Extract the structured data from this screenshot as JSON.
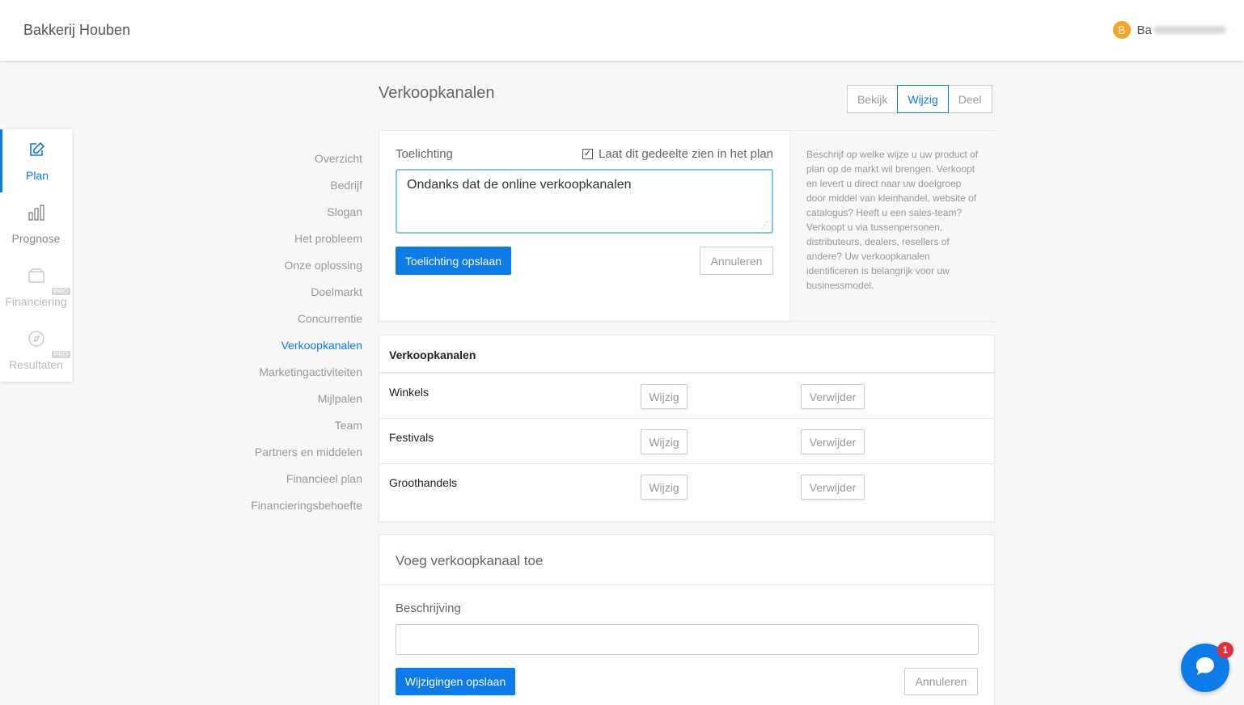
{
  "app": {
    "title": "Bakkerij Houben"
  },
  "user": {
    "avatar_letter": "B",
    "name_visible": "Ba"
  },
  "rail": [
    {
      "label": "Plan",
      "icon": "edit-icon",
      "state": "active"
    },
    {
      "label": "Prognose",
      "icon": "bar-chart-icon",
      "state": "normal"
    },
    {
      "label": "Financiering",
      "icon": "wallet-icon",
      "state": "disabled",
      "badge": "PRO"
    },
    {
      "label": "Resultaten",
      "icon": "compass-icon",
      "state": "disabled",
      "badge": "PRO"
    }
  ],
  "subnav": [
    "Overzicht",
    "Bedrijf",
    "Slogan",
    "Het probleem",
    "Onze oplossing",
    "Doelmarkt",
    "Concurrentie",
    "Verkoopkanalen",
    "Marketingactiviteiten",
    "Mijlpalen",
    "Team",
    "Partners en middelen",
    "Financieel plan",
    "Financieringsbehoefte"
  ],
  "subnav_active": "Verkoopkanalen",
  "page": {
    "title": "Verkoopkanalen"
  },
  "view_modes": {
    "items": [
      "Bekijk",
      "Wijzig",
      "Deel"
    ],
    "active": "Wijzig"
  },
  "explanation": {
    "label": "Toelichting",
    "show_in_plan_label": "Laat dit gedeelte zien in het plan",
    "show_in_plan_checked": true,
    "text": "Ondanks dat de online verkoopkanalen",
    "save_label": "Toelichting opslaan",
    "cancel_label": "Annuleren",
    "help": "Beschrijf op welke wijze u uw product of plan op de markt wil brengen. Verkoopt en levert u direct naar uw doelgroep door middel van kleinhandel, website of catalogus? Heeft u een sales-team? Verkoopt u via tussenpersonen, distributeurs, dealers, resellers of andere? Uw verkoopkanalen identificeren is belangrijk voor uw businessmodel."
  },
  "channels": {
    "header": "Verkoopkanalen",
    "edit_label": "Wijzig",
    "delete_label": "Verwijder",
    "rows": [
      "Winkels",
      "Festivals",
      "Groothandels"
    ]
  },
  "add_channel": {
    "title": "Voeg verkoopkanaal toe",
    "field_label": "Beschrijving",
    "field_value": "",
    "save_label": "Wijzigingen opslaan",
    "cancel_label": "Annuleren"
  },
  "chat": {
    "unread": "1"
  },
  "colors": {
    "accent": "#0d7be8",
    "badge": "#e0303b",
    "avatar": "#f5a623"
  }
}
